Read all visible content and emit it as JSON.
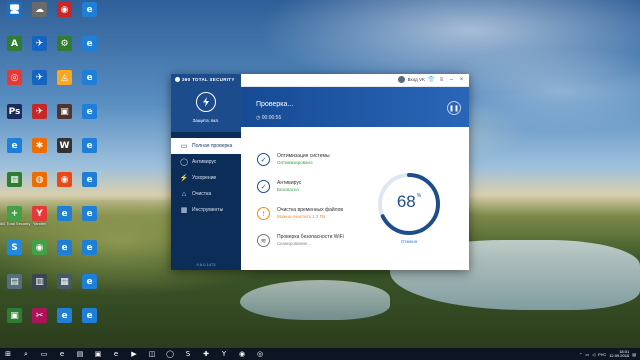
{
  "desktop": {
    "icons": [
      {
        "label": "",
        "glyph": "🖥",
        "color": "#1a6fc4"
      },
      {
        "label": "",
        "glyph": "☁",
        "color": "#6a6a6a"
      },
      {
        "label": "",
        "glyph": "◉",
        "color": "#c62828"
      },
      {
        "label": "",
        "glyph": "e",
        "color": "#1f7fd6"
      },
      {
        "label": "",
        "glyph": "A",
        "color": "#2e7d32"
      },
      {
        "label": "",
        "glyph": "✈",
        "color": "#1565c0"
      },
      {
        "label": "",
        "glyph": "⚙",
        "color": "#2e7d32"
      },
      {
        "label": "",
        "glyph": "e",
        "color": "#1f7fd6"
      },
      {
        "label": "",
        "glyph": "◎",
        "color": "#e53935"
      },
      {
        "label": "",
        "glyph": "✈",
        "color": "#1565c0"
      },
      {
        "label": "",
        "glyph": "◬",
        "color": "#f9a825"
      },
      {
        "label": "",
        "glyph": "e",
        "color": "#1f7fd6"
      },
      {
        "label": "",
        "glyph": "Ps",
        "color": "#1b2a5b"
      },
      {
        "label": "",
        "glyph": "✈",
        "color": "#c62828"
      },
      {
        "label": "",
        "glyph": "▣",
        "color": "#4e342e"
      },
      {
        "label": "",
        "glyph": "e",
        "color": "#1f7fd6"
      },
      {
        "label": "",
        "glyph": "e",
        "color": "#1f7fd6"
      },
      {
        "label": "",
        "glyph": "✱",
        "color": "#ef6c00"
      },
      {
        "label": "",
        "glyph": "W",
        "color": "#333333"
      },
      {
        "label": "",
        "glyph": "e",
        "color": "#1f7fd6"
      },
      {
        "label": "",
        "glyph": "▦",
        "color": "#2e7d32"
      },
      {
        "label": "",
        "glyph": "◍",
        "color": "#ef6c00"
      },
      {
        "label": "",
        "glyph": "◉",
        "color": "#e64a19"
      },
      {
        "label": "",
        "glyph": "e",
        "color": "#1f7fd6"
      },
      {
        "label": "360 Total Security",
        "glyph": "+",
        "color": "#43a047"
      },
      {
        "label": "Yandex",
        "glyph": "Y",
        "color": "#e53935"
      },
      {
        "label": "",
        "glyph": "e",
        "color": "#1f7fd6"
      },
      {
        "label": "",
        "glyph": "e",
        "color": "#1f7fd6"
      },
      {
        "label": "",
        "glyph": "S",
        "color": "#1e88e5"
      },
      {
        "label": "",
        "glyph": "◉",
        "color": "#43a047"
      },
      {
        "label": "",
        "glyph": "e",
        "color": "#1f7fd6"
      },
      {
        "label": "",
        "glyph": "e",
        "color": "#1f7fd6"
      },
      {
        "label": "",
        "glyph": "▤",
        "color": "#546e7a"
      },
      {
        "label": "",
        "glyph": "▥",
        "color": "#37474f"
      },
      {
        "label": "",
        "glyph": "▦",
        "color": "#455a64"
      },
      {
        "label": "",
        "glyph": "e",
        "color": "#1f7fd6"
      },
      {
        "label": "",
        "glyph": "▣",
        "color": "#2e7d32"
      },
      {
        "label": "",
        "glyph": "✂",
        "color": "#ad1457"
      },
      {
        "label": "",
        "glyph": "e",
        "color": "#1f7fd6"
      },
      {
        "label": "",
        "glyph": "e",
        "color": "#1f7fd6"
      }
    ]
  },
  "window": {
    "brand": "360 TOTAL SECURITY",
    "titlebar": {
      "user": "Вход VK",
      "user_icon": "avatar-icon",
      "buttons": [
        {
          "name": "shirt-icon",
          "glyph": "👕"
        },
        {
          "name": "menu-icon",
          "glyph": "≡"
        },
        {
          "name": "minimize-icon",
          "glyph": "–"
        },
        {
          "name": "close-icon",
          "glyph": "×"
        }
      ]
    },
    "sidebar": {
      "protection_label": "Защита: вкл.",
      "items": [
        {
          "label": "Полная проверка",
          "icon": "▭",
          "active": true
        },
        {
          "label": "Антивирус",
          "icon": "◯",
          "active": false
        },
        {
          "label": "Ускорение",
          "icon": "⚡",
          "active": false
        },
        {
          "label": "Очистка",
          "icon": "⌂",
          "active": false
        },
        {
          "label": "Инструменты",
          "icon": "▦",
          "active": false
        }
      ],
      "version": "9.6.0.1473"
    },
    "banner": {
      "title": "Проверка...",
      "time": "00:00:55"
    },
    "scan_items": [
      {
        "title": "Оптимизация системы",
        "status": "Оптимизировано",
        "status_color": "#3aa34a",
        "state": "done"
      },
      {
        "title": "Антивирус",
        "status": "Безопасно",
        "status_color": "#3aa34a",
        "state": "done"
      },
      {
        "title": "Очистка временных файлов",
        "status": "Можно очистить 1.2 ГБ",
        "status_color": "#f28a1a",
        "state": "warn"
      },
      {
        "title": "Проверка безопасности WiFi",
        "status": "Сканирование...",
        "status_color": "#888888",
        "state": "scanning"
      }
    ],
    "gauge": {
      "value": 68,
      "unit": "%",
      "progress": 0.68,
      "track_color": "#dde6f2",
      "fill_color": "#1e4d8c"
    },
    "cancel_label": "Отмена"
  },
  "taskbar": {
    "clock_time": "18:01",
    "clock_date": "12.09.2016",
    "lang": "РУС",
    "apps": [
      {
        "name": "start-icon",
        "glyph": "⊞"
      },
      {
        "name": "search-icon",
        "glyph": "⌕"
      },
      {
        "name": "task-view-icon",
        "glyph": "▭"
      },
      {
        "name": "edge-icon",
        "glyph": "e"
      },
      {
        "name": "explorer-icon",
        "glyph": "▤"
      },
      {
        "name": "store-icon",
        "glyph": "▣"
      },
      {
        "name": "ie-icon",
        "glyph": "e"
      },
      {
        "name": "media-icon",
        "glyph": "▶"
      },
      {
        "name": "photos-icon",
        "glyph": "◫"
      },
      {
        "name": "opera-icon",
        "glyph": "◯"
      },
      {
        "name": "skype-icon",
        "glyph": "S"
      },
      {
        "name": "security-icon",
        "glyph": "✚"
      },
      {
        "name": "yandex-icon",
        "glyph": "Y"
      },
      {
        "name": "app-icon",
        "glyph": "◉"
      },
      {
        "name": "app2-icon",
        "glyph": "◎"
      }
    ]
  }
}
